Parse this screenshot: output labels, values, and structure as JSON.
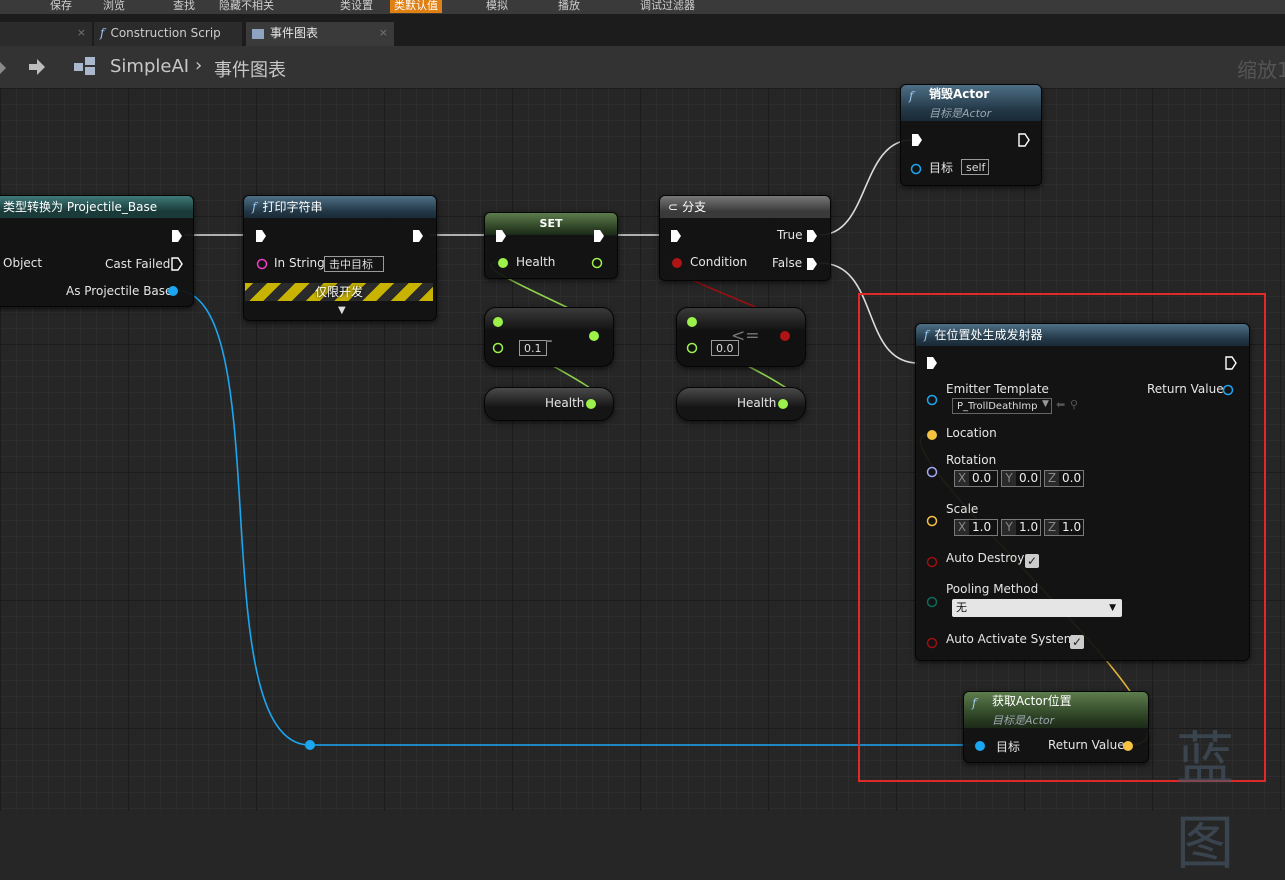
{
  "toolbar": {
    "items": [
      "保存",
      "浏览",
      "查找",
      "隐藏不相关",
      "类设置",
      "类默认值",
      "模拟",
      "播放",
      "调试过滤器"
    ]
  },
  "tabs": [
    {
      "label": "Construction Scrip",
      "close": "×"
    },
    {
      "label": "事件图表",
      "close": "×"
    }
  ],
  "breadcrumb": {
    "root": "SimpleAI",
    "separator": "›",
    "current": "事件图表",
    "zoom": "缩放1"
  },
  "nodes": {
    "cast": {
      "title": "类型转换为 Projectile_Base",
      "object": "Object",
      "cast_failed": "Cast Failed",
      "as": "As Projectile Base"
    },
    "print": {
      "title": "打印字符串",
      "in_string": "In String",
      "value": "击中目标",
      "dev_only": "仅限开发",
      "expand": "▼"
    },
    "set": {
      "title": "SET",
      "health": "Health"
    },
    "subtract": {
      "symbol": "-",
      "value": "0.1"
    },
    "get_health_1": {
      "label": "Health"
    },
    "branch": {
      "title": "分支",
      "condition": "Condition",
      "true": "True",
      "false": "False"
    },
    "lte": {
      "symbol": "<=",
      "value": "0.0"
    },
    "get_health_2": {
      "label": "Health"
    },
    "destroy": {
      "title": "销毁Actor",
      "subtitle": "目标是Actor",
      "target": "目标",
      "self": "self"
    },
    "spawn": {
      "title": "在位置处生成发射器",
      "emitter_template": "Emitter Template",
      "emitter_value": "P_TrollDeathImp",
      "return_value": "Return Value",
      "location": "Location",
      "rotation": "Rotation",
      "rotation_vals": {
        "x": "0.0",
        "y": "0.0",
        "z": "0.0"
      },
      "scale": "Scale",
      "scale_vals": {
        "x": "1.0",
        "y": "1.0",
        "z": "1.0"
      },
      "auto_destroy": "Auto Destroy",
      "pooling": "Pooling Method",
      "pooling_value": "无",
      "auto_activate": "Auto Activate System",
      "check": "✓"
    },
    "getloc": {
      "title": "获取Actor位置",
      "subtitle": "目标是Actor",
      "target": "目标",
      "return_value": "Return Value"
    }
  },
  "axis_labels": {
    "x": "X",
    "y": "Y",
    "z": "Z"
  },
  "watermark": "蓝图",
  "colors": {
    "exec": "#ffffff",
    "object_pin": "#1ba6f0",
    "float_pin": "#9cf24a",
    "bool_pin": "#9b0f0f",
    "vector_pin": "#f5c242",
    "rotator_pin": "#a3a8f5",
    "byte_pin": "#0c6b5f",
    "highlight": "#e02a2a",
    "toolbar_active": "#e07f12"
  }
}
